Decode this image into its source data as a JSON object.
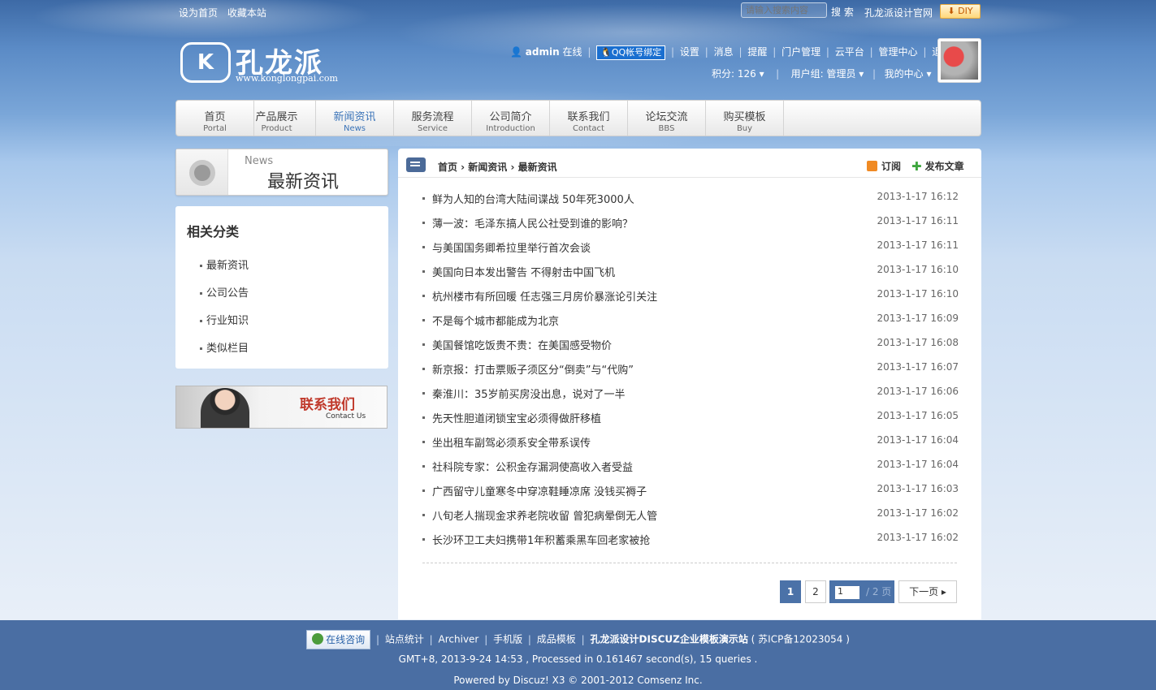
{
  "topbar": {
    "set_home": "设为首页",
    "bookmark": "收藏本站",
    "search_placeholder": "请输入搜索内容",
    "search_button": "搜 索",
    "official_site": "孔龙派设计官网",
    "diy_button": "DIY"
  },
  "logo": {
    "mark": "K",
    "name": "孔龙派",
    "url": "www.konglongpai.com"
  },
  "user": {
    "username": "admin",
    "status": "在线",
    "qq_bind": "QQ帐号绑定",
    "links": [
      "设置",
      "消息",
      "提醒",
      "门户管理",
      "云平台",
      "管理中心",
      "退出"
    ],
    "points": "积分: 126",
    "group": "用户组: 管理员",
    "my_center": "我的中心"
  },
  "nav": {
    "items": [
      {
        "cn": "首页",
        "en": "Portal"
      },
      {
        "cn": "产品展示",
        "en": "Product"
      },
      {
        "cn": "新闻资讯",
        "en": "News"
      },
      {
        "cn": "服务流程",
        "en": "Service"
      },
      {
        "cn": "公司简介",
        "en": "Introduction"
      },
      {
        "cn": "联系我们",
        "en": "Contact"
      },
      {
        "cn": "论坛交流",
        "en": "BBS"
      },
      {
        "cn": "购买模板",
        "en": "Buy"
      }
    ],
    "active_index": 2
  },
  "sidebar": {
    "section_en": "News",
    "section_cn": "最新资讯",
    "category_title": "相关分类",
    "categories": [
      "最新资讯",
      "公司公告",
      "行业知识",
      "类似栏目"
    ],
    "contact_cn": "联系我们",
    "contact_en": "Contact Us"
  },
  "main": {
    "breadcrumb": "首页 › 新闻资讯 › 最新资讯",
    "subscribe": "订阅",
    "post_article": "发布文章",
    "articles": [
      {
        "title": "鲜为人知的台湾大陆间谍战 50年死3000人",
        "time": "2013-1-17 16:12"
      },
      {
        "title": "薄一波：毛泽东搞人民公社受到谁的影响？",
        "time": "2013-1-17 16:11"
      },
      {
        "title": "与美国国务卿希拉里举行首次会谈",
        "time": "2013-1-17 16:11"
      },
      {
        "title": "美国向日本发出警告 不得射击中国飞机",
        "time": "2013-1-17 16:10"
      },
      {
        "title": "杭州楼市有所回暖 任志强三月房价暴涨论引关注",
        "time": "2013-1-17 16:10"
      },
      {
        "title": "不是每个城市都能成为北京",
        "time": "2013-1-17 16:09"
      },
      {
        "title": "美国餐馆吃饭贵不贵：在美国感受物价",
        "time": "2013-1-17 16:08"
      },
      {
        "title": "新京报：打击票贩子须区分“倒卖”与“代购”",
        "time": "2013-1-17 16:07"
      },
      {
        "title": "秦淮川：35岁前买房没出息，说对了一半",
        "time": "2013-1-17 16:06"
      },
      {
        "title": "先天性胆道闭锁宝宝必须得做肝移植",
        "time": "2013-1-17 16:05"
      },
      {
        "title": "坐出租车副驾必须系安全带系误传",
        "time": "2013-1-17 16:04"
      },
      {
        "title": "社科院专家：公积金存漏洞使高收入者受益",
        "time": "2013-1-17 16:04"
      },
      {
        "title": "广西留守儿童寒冬中穿凉鞋睡凉席 没钱买褥子",
        "time": "2013-1-17 16:03"
      },
      {
        "title": "八旬老人揣现金求养老院收留 曾犯病晕倒无人管",
        "time": "2013-1-17 16:02"
      },
      {
        "title": "长沙环卫工夫妇携带1年积蓄乘黑车回老家被抢",
        "time": "2013-1-17 16:02"
      }
    ]
  },
  "pager": {
    "page1": "1",
    "page2": "2",
    "jump_value": "1",
    "total": "/ 2 页",
    "next": "下一页"
  },
  "footer": {
    "online_consult": "在线咨询",
    "links": [
      "站点统计",
      "Archiver",
      "手机版",
      "成品模板"
    ],
    "site_name": "孔龙派设计DISCUZ企业模板演示站",
    "icp": "( 苏ICP备12023054 )",
    "stats": "GMT+8, 2013-9-24 14:53 , Processed in 0.161467 second(s), 15 queries .",
    "powered": "Powered by Discuz! X3 © 2001-2012 Comsenz Inc."
  }
}
